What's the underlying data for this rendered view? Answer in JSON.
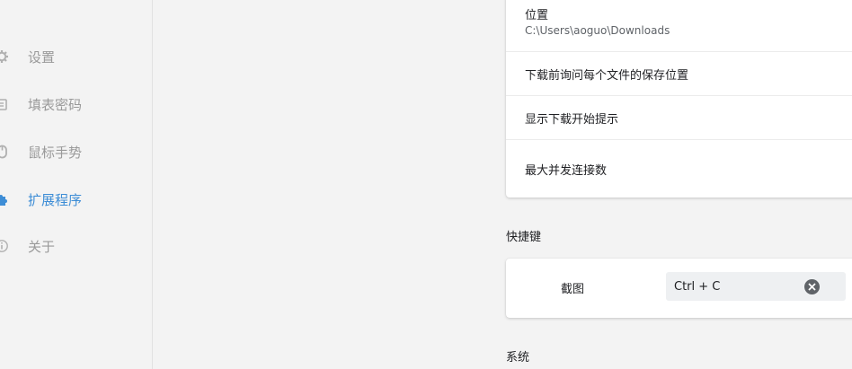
{
  "sidebar": {
    "items": [
      {
        "label": "设置",
        "icon": "gear-icon",
        "active": false
      },
      {
        "label": "填表密码",
        "icon": "form-password-icon",
        "active": false
      },
      {
        "label": "鼠标手势",
        "icon": "mouse-icon",
        "active": false
      },
      {
        "label": "扩展程序",
        "icon": "puzzle-icon",
        "active": true
      },
      {
        "label": "关于",
        "icon": "info-icon",
        "active": false
      }
    ],
    "active_color": "#3d8dd6",
    "inactive_color": "#9a9a9a"
  },
  "downloads": {
    "location_label": "位置",
    "location_value": "C:\\Users\\aoguo\\Downloads",
    "ask_location_label": "下载前询问每个文件的保存位置",
    "show_start_tip_label": "显示下载开始提示",
    "max_connections_label": "最大并发连接数"
  },
  "shortcuts": {
    "section_title": "快捷键",
    "screenshot_label": "截图",
    "screenshot_value": "Ctrl + C",
    "clear_icon": "clear-circle-icon"
  },
  "system": {
    "section_title": "系统"
  }
}
